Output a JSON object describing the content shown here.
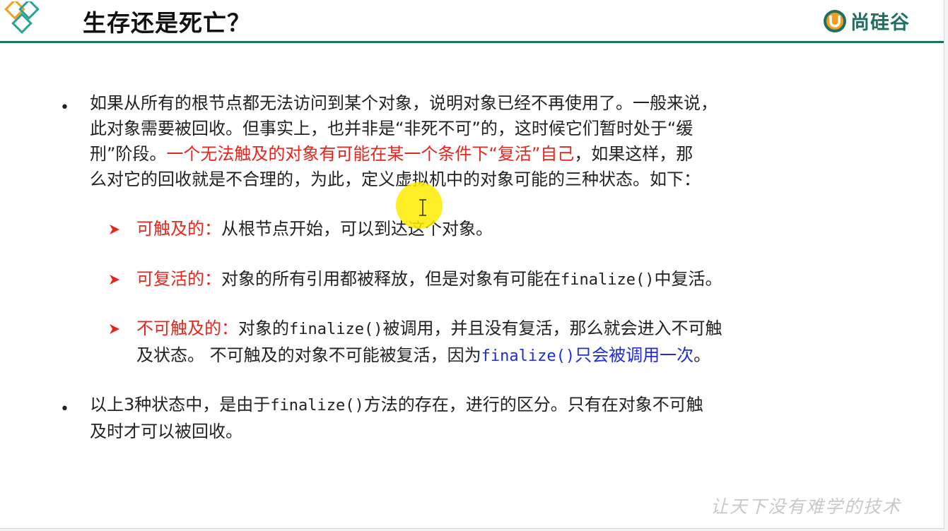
{
  "slide": {
    "title": "生存还是死亡？",
    "brand": "尚硅谷",
    "watermark": "让天下没有难学的技术"
  },
  "bullet1": {
    "marker": "•",
    "line1": "如果从所有的根节点都无法访问到某个对象，说明对象已经不再使用了。一般来说，",
    "line2": "此对象需要被回收。但事实上，也并非是“非死不可”的，这时候它们暂时处于“缓",
    "line3_start": "刑”阶段。",
    "line3_red": "一个无法触及的对象有可能在某一个条件下“复活”自己",
    "line3_end": "，如果这样，那",
    "line4": "么对它的回收就是不合理的，为此，定义虚拟机中的对象可能的三种状态。如下："
  },
  "states": [
    {
      "label": "可触及的：",
      "text": "从根节点开始，可以到达这个对象。"
    },
    {
      "label": "可复活的：",
      "text_before": "对象的所有引用都被释放，但是对象有可能在",
      "code": "finalize()",
      "text_after": "中复活。"
    },
    {
      "label": "不可触及的：",
      "line1_a": "对象的",
      "line1_code": "finalize()",
      "line1_b": "被调用，并且没有复活，那么就会进入不可触",
      "line2_a": "及状态。  不可触及的对象不可能被复活，因为",
      "line2_blue_code": "finalize()",
      "line2_blue_text": "只会被调用一次",
      "line2_end": "。"
    }
  ],
  "bullet2": {
    "marker": "•",
    "line1_a": "以上3种状态中，是由于",
    "line1_code": "finalize()",
    "line1_b": "方法的存在，进行的区分。只有在对象不可触",
    "line2": "及时才可以被回收。"
  },
  "colors": {
    "accent_red": "#e8251c",
    "accent_blue": "#1d2bd8",
    "brand_green": "#1f6f62",
    "highlight_yellow": "#ffeb00"
  }
}
